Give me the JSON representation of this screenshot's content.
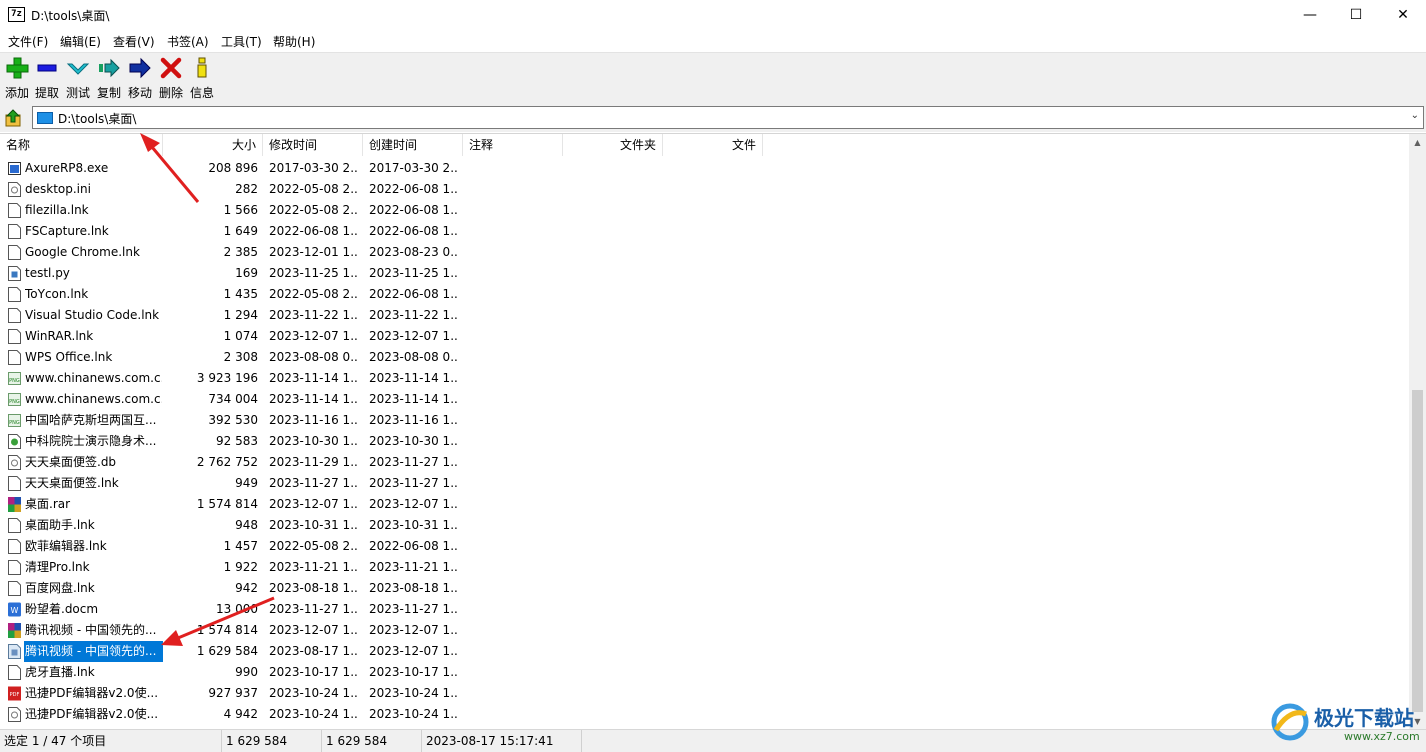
{
  "window": {
    "title": "D:\\tools\\桌面\\",
    "app_icon_text": "7z",
    "min_symbol": "—",
    "max_symbol": "☐",
    "close_symbol": "✕"
  },
  "menu": [
    "文件(F)",
    "编辑(E)",
    "查看(V)",
    "书签(A)",
    "工具(T)",
    "帮助(H)"
  ],
  "toolbar": [
    {
      "label": "添加",
      "icon": "plus-icon"
    },
    {
      "label": "提取",
      "icon": "minus-icon"
    },
    {
      "label": "测试",
      "icon": "check-icon"
    },
    {
      "label": "复制",
      "icon": "copy-arrow-icon"
    },
    {
      "label": "移动",
      "icon": "move-arrow-icon"
    },
    {
      "label": "删除",
      "icon": "delete-x-icon"
    },
    {
      "label": "信息",
      "icon": "info-icon"
    }
  ],
  "address": {
    "path": "D:\\tools\\桌面\\"
  },
  "columns": [
    "名称",
    "大小",
    "修改时间",
    "创建时间",
    "注释",
    "文件夹",
    "文件"
  ],
  "files": [
    {
      "name": "AxureRP8.exe",
      "size": "208 896",
      "modified": "2017-03-30 2...",
      "created": "2017-03-30 2...",
      "icon": "exe"
    },
    {
      "name": "desktop.ini",
      "size": "282",
      "modified": "2022-05-08 2...",
      "created": "2022-06-08 1...",
      "icon": "ini"
    },
    {
      "name": "filezilla.lnk",
      "size": "1 566",
      "modified": "2022-05-08 2...",
      "created": "2022-06-08 1...",
      "icon": "file"
    },
    {
      "name": "FSCapture.lnk",
      "size": "1 649",
      "modified": "2022-06-08 1...",
      "created": "2022-06-08 1...",
      "icon": "file"
    },
    {
      "name": "Google Chrome.lnk",
      "size": "2 385",
      "modified": "2023-12-01 1...",
      "created": "2023-08-23 0...",
      "icon": "file"
    },
    {
      "name": "testl.py",
      "size": "169",
      "modified": "2023-11-25 1...",
      "created": "2023-11-25 1...",
      "icon": "py"
    },
    {
      "name": "ToYcon.lnk",
      "size": "1 435",
      "modified": "2022-05-08 2...",
      "created": "2022-06-08 1...",
      "icon": "file"
    },
    {
      "name": "Visual Studio Code.lnk",
      "size": "1 294",
      "modified": "2023-11-22 1...",
      "created": "2023-11-22 1...",
      "icon": "file"
    },
    {
      "name": "WinRAR.lnk",
      "size": "1 074",
      "modified": "2023-12-07 1...",
      "created": "2023-12-07 1...",
      "icon": "file"
    },
    {
      "name": "WPS Office.lnk",
      "size": "2 308",
      "modified": "2023-08-08 0...",
      "created": "2023-08-08 0...",
      "icon": "file"
    },
    {
      "name": "www.chinanews.com.c...",
      "size": "3 923 196",
      "modified": "2023-11-14 1...",
      "created": "2023-11-14 1...",
      "icon": "png"
    },
    {
      "name": "www.chinanews.com.c...",
      "size": "734 004",
      "modified": "2023-11-14 1...",
      "created": "2023-11-14 1...",
      "icon": "png"
    },
    {
      "name": "中国哈萨克斯坦两国互...",
      "size": "392 530",
      "modified": "2023-11-16 1...",
      "created": "2023-11-16 1...",
      "icon": "png"
    },
    {
      "name": "中科院院士演示隐身术...",
      "size": "92 583",
      "modified": "2023-10-30 1...",
      "created": "2023-10-30 1...",
      "icon": "web"
    },
    {
      "name": "天天桌面便签.db",
      "size": "2 762 752",
      "modified": "2023-11-29 1...",
      "created": "2023-11-27 1...",
      "icon": "ini"
    },
    {
      "name": "天天桌面便签.lnk",
      "size": "949",
      "modified": "2023-11-27 1...",
      "created": "2023-11-27 1...",
      "icon": "file"
    },
    {
      "name": "桌面.rar",
      "size": "1 574 814",
      "modified": "2023-12-07 1...",
      "created": "2023-12-07 1...",
      "icon": "rar"
    },
    {
      "name": "桌面助手.lnk",
      "size": "948",
      "modified": "2023-10-31 1...",
      "created": "2023-10-31 1...",
      "icon": "file"
    },
    {
      "name": "欧菲编辑器.lnk",
      "size": "1 457",
      "modified": "2022-05-08 2...",
      "created": "2022-06-08 1...",
      "icon": "file"
    },
    {
      "name": "清理Pro.lnk",
      "size": "1 922",
      "modified": "2023-11-21 1...",
      "created": "2023-11-21 1...",
      "icon": "file"
    },
    {
      "name": "百度网盘.lnk",
      "size": "942",
      "modified": "2023-08-18 1...",
      "created": "2023-08-18 1...",
      "icon": "file"
    },
    {
      "name": "盼望着.docm",
      "size": "13 000",
      "modified": "2023-11-27 1...",
      "created": "2023-11-27 1...",
      "icon": "doc"
    },
    {
      "name": "腾讯视频 - 中国领先的...",
      "size": "1 574 814",
      "modified": "2023-12-07 1...",
      "created": "2023-12-07 1...",
      "icon": "rar"
    },
    {
      "name": "腾讯视频 - 中国领先的...",
      "size": "1 629 584",
      "modified": "2023-08-17 1...",
      "created": "2023-12-07 1...",
      "icon": "zip",
      "selected": true
    },
    {
      "name": "虎牙直播.lnk",
      "size": "990",
      "modified": "2023-10-17 1...",
      "created": "2023-10-17 1...",
      "icon": "file"
    },
    {
      "name": "迅捷PDF编辑器v2.0使...",
      "size": "927 937",
      "modified": "2023-10-24 1...",
      "created": "2023-10-24 1...",
      "icon": "pdf"
    },
    {
      "name": "迅捷PDF编辑器v2.0使...",
      "size": "4 942",
      "modified": "2023-10-24 1...",
      "created": "2023-10-24 1...",
      "icon": "ini"
    }
  ],
  "status": {
    "selection": "选定 1 / 47 个项目",
    "size": "1 629 584",
    "packed": "1 629 584",
    "date": "2023-08-17 15:17:41"
  },
  "watermark": {
    "title": "极光下载站",
    "url": "www.xz7.com"
  },
  "colors": {
    "selection": "#0078d7",
    "arrow": "#e02020",
    "toolbar_bg": "#f0f0f0"
  }
}
